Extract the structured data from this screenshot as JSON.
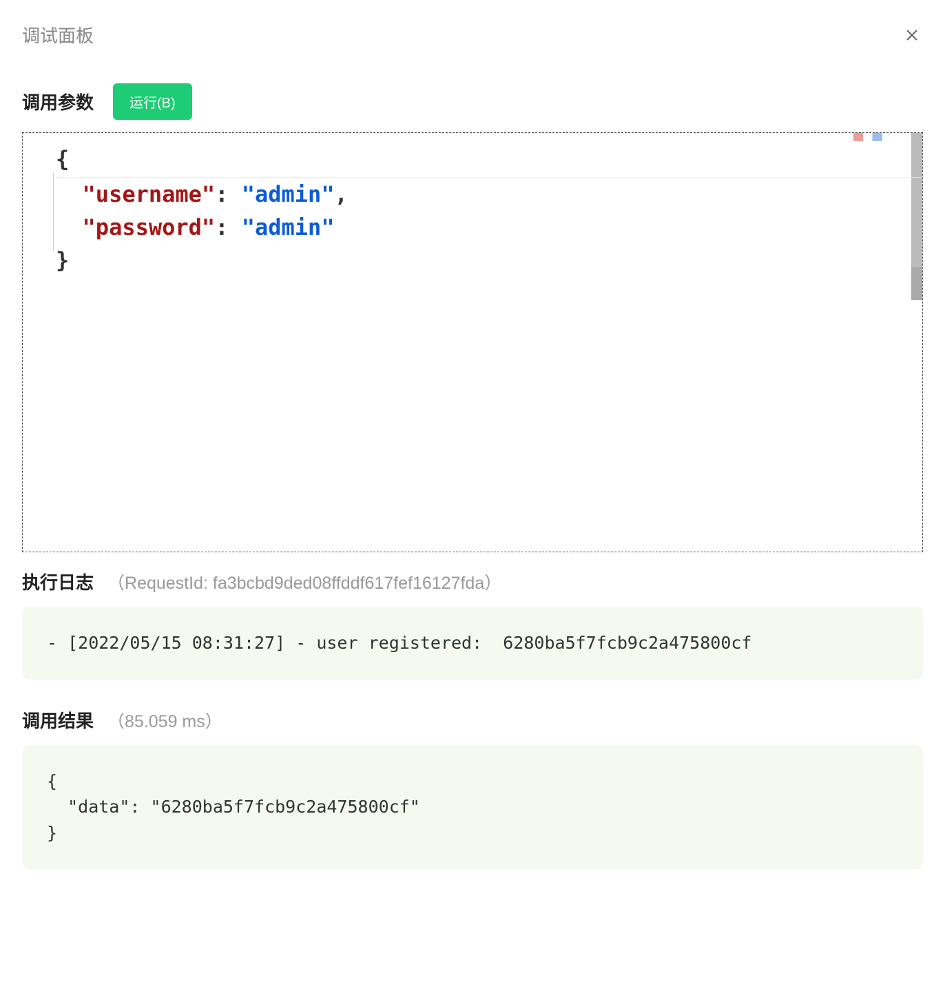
{
  "header": {
    "title": "调试面板"
  },
  "params": {
    "section_title": "调用参数",
    "run_button_label": "运行(B)",
    "code_lines": {
      "l1": "{",
      "l2_key": "\"username\"",
      "l2_colon": ": ",
      "l2_val": "\"admin\"",
      "l2_end": ",",
      "l3_key": "\"password\"",
      "l3_colon": ": ",
      "l3_val": "\"admin\"",
      "l4": "}"
    }
  },
  "log": {
    "section_title": "执行日志",
    "meta": "（RequestId: fa3bcbd9ded08ffddf617fef16127fda）",
    "content": "- [2022/05/15 08:31:27] - user registered:  6280ba5f7fcb9c2a475800cf"
  },
  "result": {
    "section_title": "调用结果",
    "meta": "（85.059 ms）",
    "content": "{\n  \"data\": \"6280ba5f7fcb9c2a475800cf\"\n}"
  }
}
